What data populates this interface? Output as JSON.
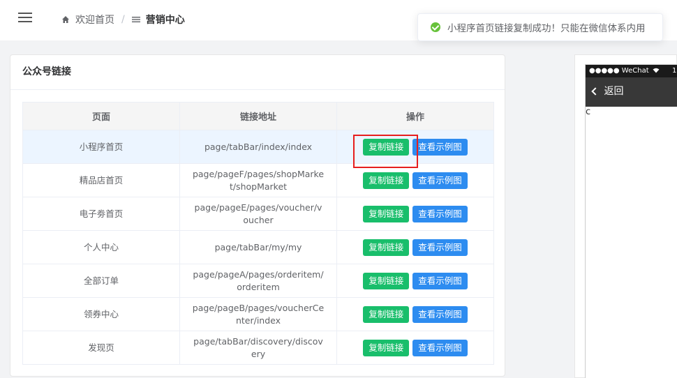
{
  "header": {
    "breadcrumb_home": "欢迎首页",
    "breadcrumb_sep": "/",
    "breadcrumb_current": "营销中心"
  },
  "toast": {
    "message": "小程序首页链接复制成功！只能在微信体系内用"
  },
  "card": {
    "title": "公众号链接",
    "columns": [
      "页面",
      "链接地址",
      "操作"
    ],
    "copy_label": "复制链接",
    "view_label": "查看示例图",
    "rows": [
      {
        "page": "小程序首页",
        "url": "page/tabBar/index/index"
      },
      {
        "page": "精品店首页",
        "url": "page/pageF/pages/shopMarket/shopMarket"
      },
      {
        "page": "电子劵首页",
        "url": "page/pageE/pages/voucher/voucher"
      },
      {
        "page": "个人中心",
        "url": "page/tabBar/my/my"
      },
      {
        "page": "全部订单",
        "url": "page/pageA/pages/orderitem/orderitem"
      },
      {
        "page": "领券中心",
        "url": "page/pageB/pages/voucherCenter/index"
      },
      {
        "page": "发现页",
        "url": "page/tabBar/discovery/discovery"
      }
    ]
  },
  "phone": {
    "status_text": "●●●●● WeChat",
    "status_extra": "1",
    "back_label": "返回",
    "nav_extra": "c"
  },
  "colors": {
    "copy_button": "#19be6b",
    "view_button": "#2d8cf0",
    "highlight_box": "#e61e1e",
    "toast_success": "#67c23a"
  }
}
